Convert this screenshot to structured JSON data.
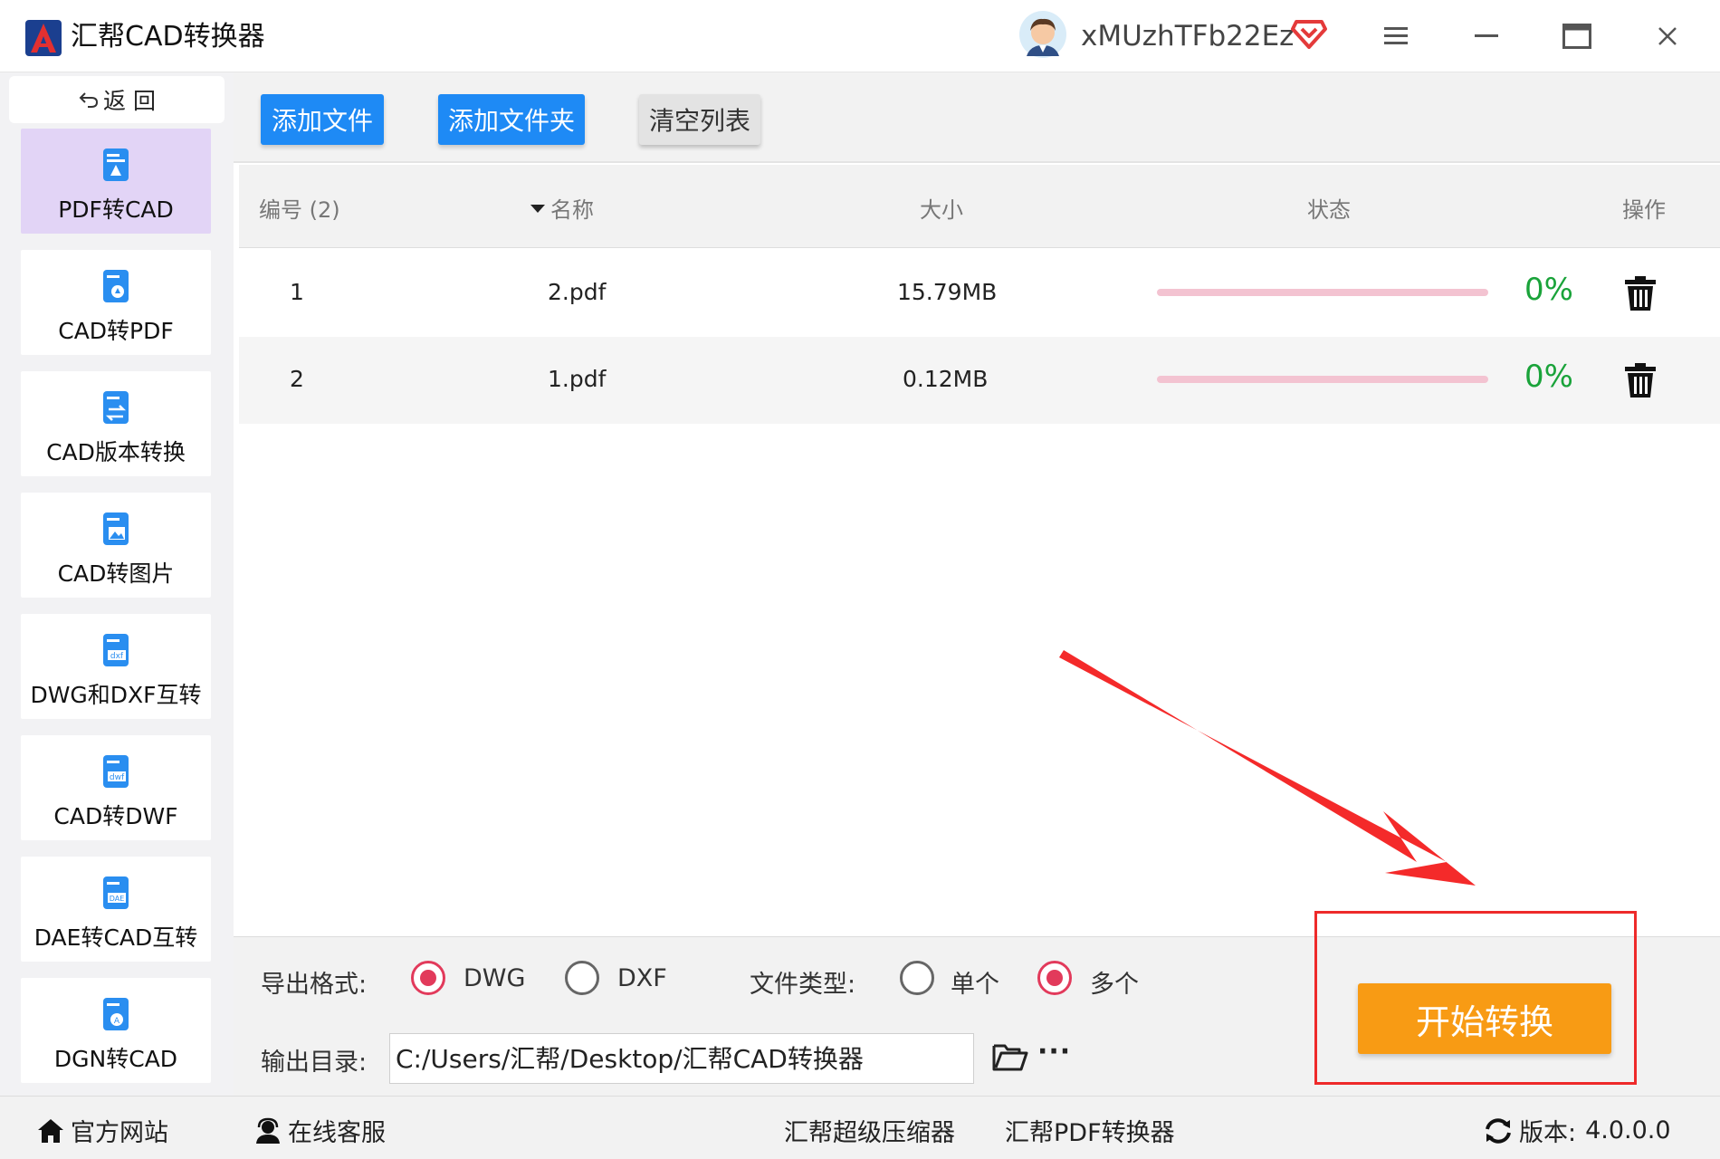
{
  "app": {
    "title": "汇帮CAD转换器",
    "username": "xMUzhTFb22Ez",
    "logo_icon": "cad-logo-icon",
    "colors": {
      "accent_blue": "#1e8af5",
      "start_orange": "#f89b14",
      "active_nav": "#e2d4f6",
      "success_green": "#1aa33a",
      "radio_red": "#e23a5b",
      "annotation_red": "#ee2a2a"
    }
  },
  "sidebar": {
    "back_label": "返 回",
    "items": [
      {
        "label": "PDF转CAD",
        "active": true
      },
      {
        "label": "CAD转PDF",
        "active": false
      },
      {
        "label": "CAD版本转换",
        "active": false
      },
      {
        "label": "CAD转图片",
        "active": false
      },
      {
        "label": "DWG和DXF互转",
        "active": false
      },
      {
        "label": "CAD转DWF",
        "active": false
      },
      {
        "label": "DAE转CAD互转",
        "active": false
      },
      {
        "label": "DGN转CAD",
        "active": false
      }
    ]
  },
  "toolbar": {
    "add_file": "添加文件",
    "add_folder": "添加文件夹",
    "clear_list": "清空列表"
  },
  "table": {
    "headers": {
      "index": "编号 (2)",
      "name": "名称",
      "size": "大小",
      "status": "状态",
      "action": "操作"
    },
    "rows": [
      {
        "index": "1",
        "name": "2.pdf",
        "size": "15.79MB",
        "progress": 0,
        "percent": "0%"
      },
      {
        "index": "2",
        "name": "1.pdf",
        "size": "0.12MB",
        "progress": 0,
        "percent": "0%"
      }
    ]
  },
  "settings": {
    "format_label": "导出格式:",
    "format_options": [
      "DWG",
      "DXF"
    ],
    "format_selected": "DWG",
    "type_label": "文件类型:",
    "type_options": [
      "单个",
      "多个"
    ],
    "type_selected": "多个",
    "output_label": "输出目录:",
    "output_path": "C:/Users/汇帮/Desktop/汇帮CAD转换器",
    "more": "···",
    "start_label": "开始转换"
  },
  "footer": {
    "website": "官方网站",
    "support": "在线客服",
    "compressor": "汇帮超级压缩器",
    "pdf_converter": "汇帮PDF转换器",
    "version_label": "版本:",
    "version": "4.0.0.0"
  }
}
